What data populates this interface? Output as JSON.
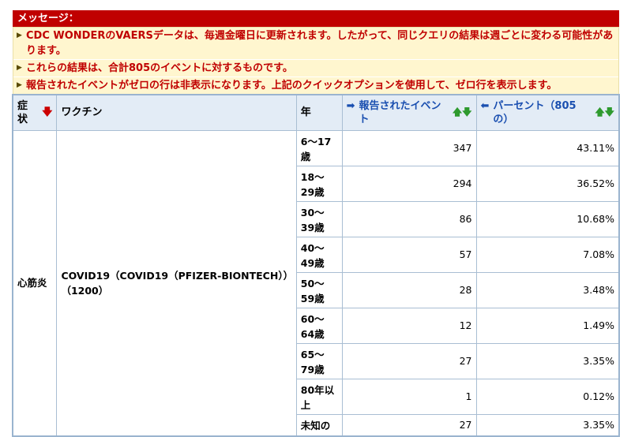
{
  "message": {
    "title": "メッセージ：",
    "items": [
      "CDC WONDERのVAERSデータは、毎週金曜日に更新されます。したがって、同じクエリの結果は週ごとに変わる可能性があります。",
      "これらの結果は、合計805のイベントに対するものです。",
      "報告されたイベントがゼロの行は非表示になります。上記のクイックオプションを使用して、ゼロ行を表示します。"
    ]
  },
  "table": {
    "headers": {
      "symptom": "症状",
      "vaccine": "ワクチン",
      "year": "年",
      "events": "報告されたイベント",
      "percent": "パーセント（805の）"
    },
    "symptom": "心筋炎",
    "vaccine": "COVID19（COVID19（PFIZER-BIONTECH））（1200）",
    "rows": [
      {
        "age": "6〜17歳",
        "events": "347",
        "percent": "43.11%"
      },
      {
        "age": "18〜29歳",
        "events": "294",
        "percent": "36.52%"
      },
      {
        "age": "30〜39歳",
        "events": "86",
        "percent": "10.68%"
      },
      {
        "age": "40〜49歳",
        "events": "57",
        "percent": "7.08%"
      },
      {
        "age": "50〜59歳",
        "events": "28",
        "percent": "3.48%"
      },
      {
        "age": "60〜64歳",
        "events": "12",
        "percent": "1.49%"
      },
      {
        "age": "65〜79歳",
        "events": "27",
        "percent": "3.35%"
      },
      {
        "age": "80年以上",
        "events": "1",
        "percent": "0.12%"
      },
      {
        "age": "未知の",
        "events": "27",
        "percent": "3.35%"
      }
    ]
  },
  "icons": {
    "message_bullet": "triangle-right-icon",
    "sort_desc": "red-down-arrow-icon",
    "move_right": "blue-right-arrow-icon",
    "move_left": "blue-left-arrow-icon",
    "sort_toggle": "green-up-down-arrows-icon"
  },
  "colors": {
    "message_header_bg": "#c00000",
    "message_body_bg": "#fff6cf",
    "message_text": "#c00000",
    "table_header_bg": "#e3ecf6",
    "link_blue": "#1a4fb0",
    "table_border": "#9ab4cf"
  }
}
